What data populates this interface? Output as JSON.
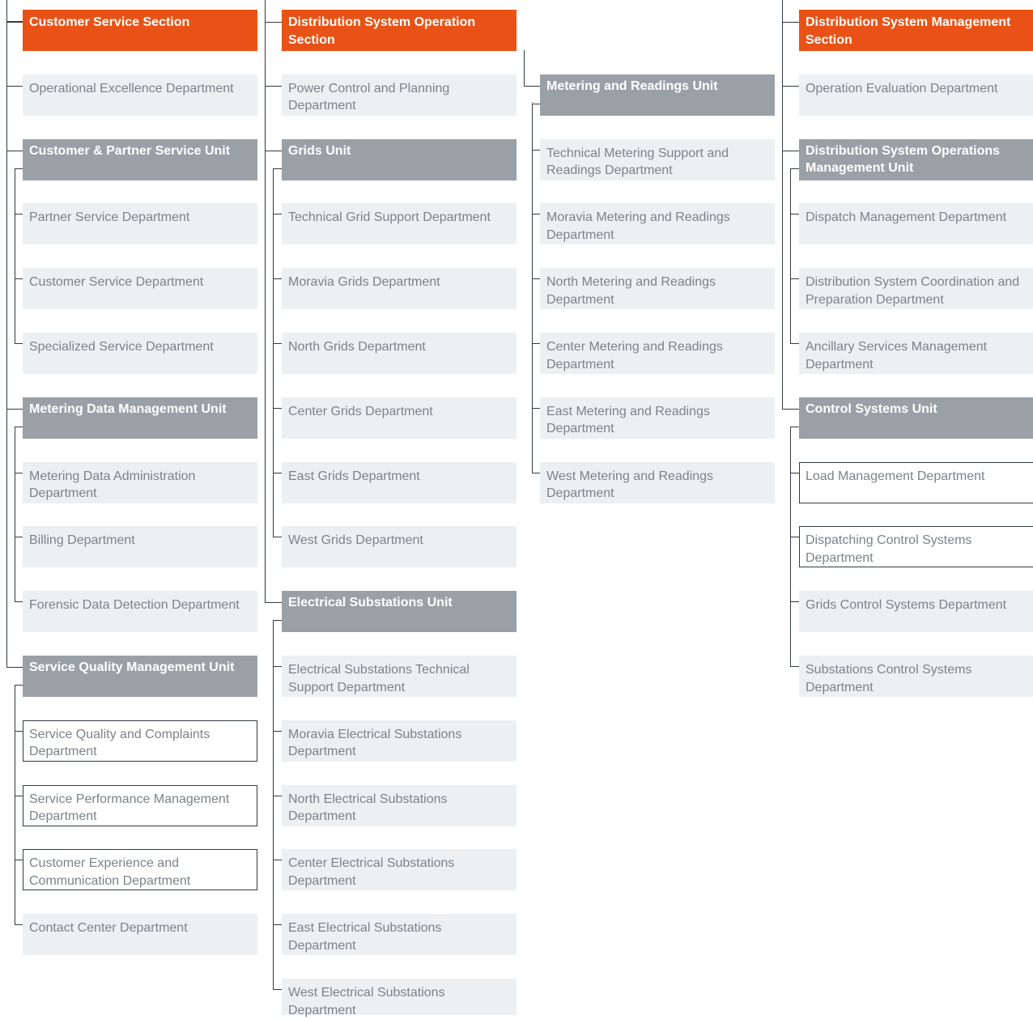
{
  "colors": {
    "section": "#e95216",
    "unit": "#9aa1a6",
    "department": "#ecf0f3",
    "department_text": "#7b838a",
    "connector": "#333b42"
  },
  "columns": [
    {
      "section": "Customer Service Section",
      "items": [
        {
          "text": "Operational Excellence Department",
          "kind": "dept"
        },
        {
          "text": "Customer & Partner Service Unit",
          "kind": "unit",
          "children": [
            {
              "text": "Partner Service Department",
              "kind": "dept"
            },
            {
              "text": "Customer Service Department",
              "kind": "dept"
            },
            {
              "text": "Specialized Service Department",
              "kind": "dept"
            }
          ]
        },
        {
          "text": "Metering Data Management Unit",
          "kind": "unit",
          "children": [
            {
              "text": "Metering Data Administration Department",
              "kind": "dept"
            },
            {
              "text": "Billing Department",
              "kind": "dept"
            },
            {
              "text": "Forensic Data Detection Department",
              "kind": "dept"
            }
          ]
        },
        {
          "text": "Service Quality Management Unit",
          "kind": "unit",
          "children": [
            {
              "text": "Service Quality and Complaints Department",
              "kind": "outlined"
            },
            {
              "text": "Service Performance Management Department",
              "kind": "outlined"
            },
            {
              "text": "Customer Experience and Communication Department",
              "kind": "outlined"
            },
            {
              "text": "Contact Center Department",
              "kind": "dept"
            }
          ]
        }
      ]
    },
    {
      "section": "Distribution System Operation Section",
      "items": [
        {
          "text": "Power Control and Planning Department",
          "kind": "dept"
        },
        {
          "text": "Grids Unit",
          "kind": "unit",
          "children": [
            {
              "text": "Technical Grid Support Department",
              "kind": "dept"
            },
            {
              "text": "Moravia Grids Department",
              "kind": "dept"
            },
            {
              "text": "North Grids Department",
              "kind": "dept"
            },
            {
              "text": "Center Grids Department",
              "kind": "dept"
            },
            {
              "text": "East Grids Department",
              "kind": "dept"
            },
            {
              "text": "West Grids Department",
              "kind": "dept"
            }
          ]
        },
        {
          "text": "Electrical Substations Unit",
          "kind": "unit",
          "children": [
            {
              "text": "Electrical Substations Technical Support Department",
              "kind": "dept"
            },
            {
              "text": "Moravia Electrical Substations Department",
              "kind": "dept"
            },
            {
              "text": "North Electrical Substations Department",
              "kind": "dept"
            },
            {
              "text": "Center Electrical Substations Department",
              "kind": "dept"
            },
            {
              "text": "East Electrical Substations Department",
              "kind": "dept"
            },
            {
              "text": "West Electrical Substations Department",
              "kind": "dept"
            }
          ]
        }
      ]
    },
    {
      "section": "",
      "items": [
        {
          "text": "Metering and Readings Unit",
          "kind": "unit",
          "children": [
            {
              "text": "Technical Metering Support and Readings Department",
              "kind": "dept"
            },
            {
              "text": "Moravia Metering and Readings Department",
              "kind": "dept"
            },
            {
              "text": "North Metering and Readings Department",
              "kind": "dept"
            },
            {
              "text": "Center Metering and Readings Department",
              "kind": "dept"
            },
            {
              "text": "East Metering and Readings Department",
              "kind": "dept"
            },
            {
              "text": "West Metering and Readings Department",
              "kind": "dept"
            }
          ]
        }
      ]
    },
    {
      "section": "Distribution System Management Section",
      "items": [
        {
          "text": "Operation Evaluation Department",
          "kind": "dept"
        },
        {
          "text": "Distribution System Operations Management Unit",
          "kind": "unit",
          "children": [
            {
              "text": "Dispatch Management Department",
              "kind": "dept"
            },
            {
              "text": "Distribution System Coordination and Preparation Department",
              "kind": "dept"
            },
            {
              "text": "Ancillary Services Management Department",
              "kind": "dept"
            }
          ]
        },
        {
          "text": "Control Systems Unit",
          "kind": "unit",
          "children": [
            {
              "text": "Load Management Department",
              "kind": "outlined"
            },
            {
              "text": "Dispatching Control Systems Department",
              "kind": "outlined"
            },
            {
              "text": "Grids Control Systems Department",
              "kind": "dept"
            },
            {
              "text": "Substations Control Systems Department",
              "kind": "dept"
            }
          ]
        }
      ]
    }
  ]
}
